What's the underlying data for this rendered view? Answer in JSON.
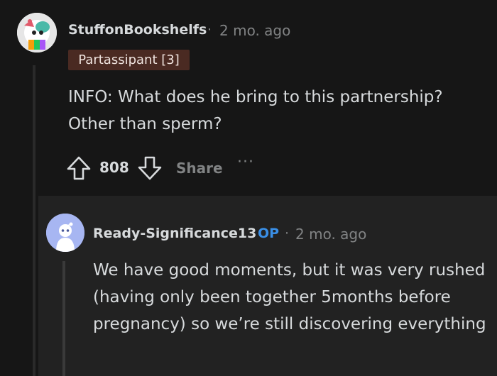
{
  "comment": {
    "author": "StuffonBookshelfs",
    "separator": "·",
    "timestamp": "2 mo. ago",
    "flair": "Partassipant [3]",
    "body": "INFO: What does he bring to this partnership? Other than sperm?",
    "score": "808",
    "share_label": "Share",
    "more_label": "···"
  },
  "reply": {
    "author": "Ready-Significance13",
    "op_label": "OP",
    "separator": "·",
    "timestamp": "2 mo. ago",
    "body": "We have good moments, but it was very rushed (having only been together 5months before pregnancy) so we’re still discovering everything"
  }
}
